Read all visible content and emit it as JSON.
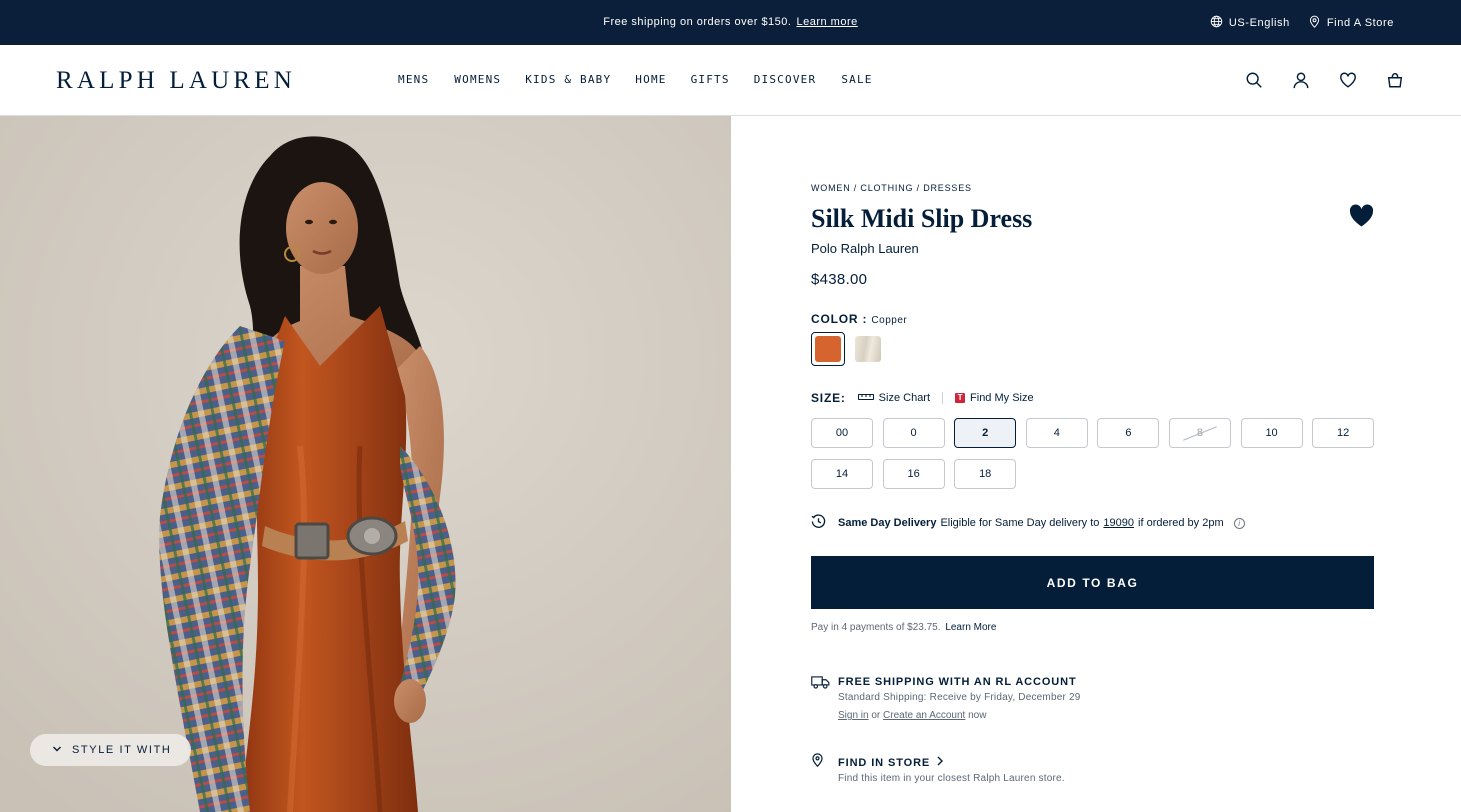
{
  "promo": {
    "text": "Free shipping on orders over $150.",
    "link": "Learn more",
    "locale": "US-English",
    "store": "Find A Store"
  },
  "header": {
    "logo": "RALPH LAUREN",
    "nav": [
      "MENS",
      "WOMENS",
      "KIDS & BABY",
      "HOME",
      "GIFTS",
      "DISCOVER",
      "SALE"
    ],
    "icons": [
      "search-icon",
      "account-icon",
      "wishlist-icon",
      "bag-icon"
    ]
  },
  "image": {
    "style_button": "STYLE IT WITH",
    "colors": {
      "background": "#d6cfc6",
      "dress": "#b0491c",
      "plaid": "#3c4f7a"
    }
  },
  "product": {
    "breadcrumb": "WOMEN / CLOTHING / DRESSES",
    "title": "Silk Midi Slip Dress",
    "brand": "Polo Ralph Lauren",
    "price": "$438.00",
    "color_label": "COLOR :",
    "color_value": "Copper",
    "swatches": [
      {
        "name": "Copper",
        "color": "#d5642f",
        "selected": true
      },
      {
        "name": "Cream",
        "color": "#e3ddd0",
        "selected": false
      }
    ],
    "size_label": "SIZE:",
    "size_chart": "Size Chart",
    "find_my_size": "Find My Size",
    "find_my_size_badge": "T",
    "sizes": [
      {
        "label": "00",
        "state": "available"
      },
      {
        "label": "0",
        "state": "available"
      },
      {
        "label": "2",
        "state": "selected"
      },
      {
        "label": "4",
        "state": "available"
      },
      {
        "label": "6",
        "state": "available"
      },
      {
        "label": "8",
        "state": "unavailable"
      },
      {
        "label": "10",
        "state": "available"
      },
      {
        "label": "12",
        "state": "available"
      },
      {
        "label": "14",
        "state": "available"
      },
      {
        "label": "16",
        "state": "available"
      },
      {
        "label": "18",
        "state": "available"
      }
    ],
    "delivery": {
      "title": "Same Day Delivery",
      "text_before": "Eligible for Same Day delivery to",
      "zip": "19090",
      "text_after": "if ordered by 2pm",
      "info_glyph": "i"
    },
    "add_to_bag": "ADD TO BAG",
    "payments": {
      "text": "Pay in 4 payments of $23.75.",
      "link": "Learn More"
    },
    "shipping": {
      "title": "FREE SHIPPING WITH AN RL ACCOUNT",
      "subtitle": "Standard Shipping: Receive by Friday, December 29",
      "sign_in": "Sign in",
      "or": "or",
      "create": "Create an Account",
      "now": "now"
    },
    "store": {
      "title": "FIND IN STORE",
      "subtitle": "Find this item in your closest Ralph Lauren store."
    },
    "accent": "#041e3a"
  }
}
